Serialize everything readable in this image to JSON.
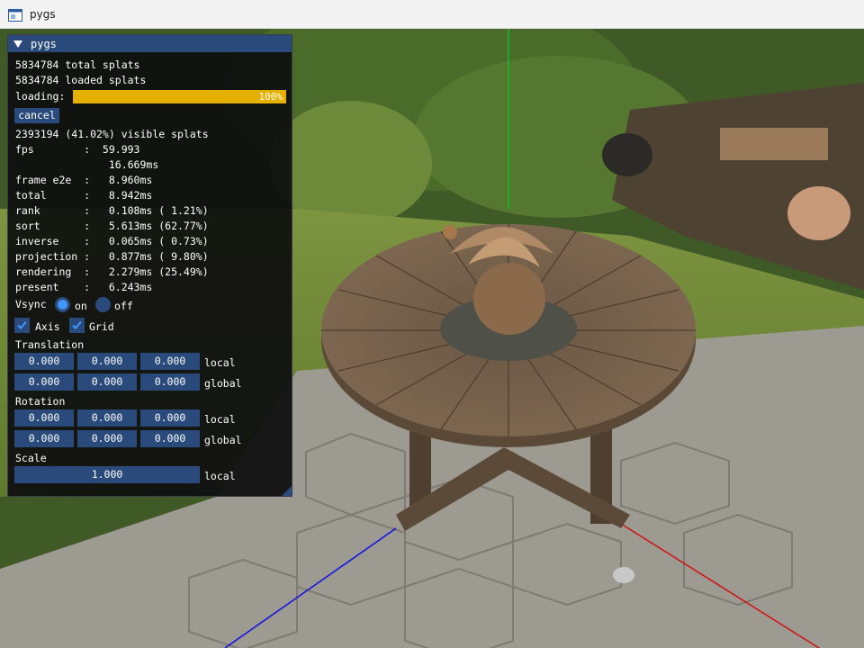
{
  "window": {
    "title": "pygs",
    "app_icon": "window-icon"
  },
  "panel": {
    "title": "pygs",
    "total_splats": "5834784 total splats",
    "loaded_splats": "5834784 loaded splats",
    "loading_label": "loading:",
    "progress_fraction": 1.0,
    "progress_text": "100%",
    "cancel_label": "cancel",
    "visible_splats": "2393194 (41.02%) visible splats",
    "stats": [
      "fps        :  59.993",
      "               16.669ms",
      "frame e2e  :   8.960ms",
      "total      :   8.942ms",
      "rank       :   0.108ms ( 1.21%)",
      "sort       :   5.613ms (62.77%)",
      "inverse    :   0.065ms ( 0.73%)",
      "projection :   0.877ms ( 9.80%)",
      "rendering  :   2.279ms (25.49%)",
      "present    :   6.243ms"
    ],
    "vsync": {
      "label": "Vsync",
      "on_label": "on",
      "off_label": "off",
      "selected": "on"
    },
    "axis": {
      "label": "Axis",
      "checked": true
    },
    "grid": {
      "label": "Grid",
      "checked": true
    },
    "translation": {
      "label": "Translation",
      "local": [
        "0.000",
        "0.000",
        "0.000"
      ],
      "local_label": "local",
      "global": [
        "0.000",
        "0.000",
        "0.000"
      ],
      "global_label": "global"
    },
    "rotation": {
      "label": "Rotation",
      "local": [
        "0.000",
        "0.000",
        "0.000"
      ],
      "local_label": "local",
      "global": [
        "0.000",
        "0.000",
        "0.000"
      ],
      "global_label": "global"
    },
    "scale": {
      "label": "Scale",
      "value": "1.000",
      "local_label": "local"
    }
  },
  "colors": {
    "panel_bg": "#0f0f0f",
    "widget": "#294a7a",
    "accent": "#4296fa",
    "progress": "#e6b000",
    "axis_x": "#d01010",
    "axis_y": "#10c020",
    "axis_z": "#1010e0"
  }
}
